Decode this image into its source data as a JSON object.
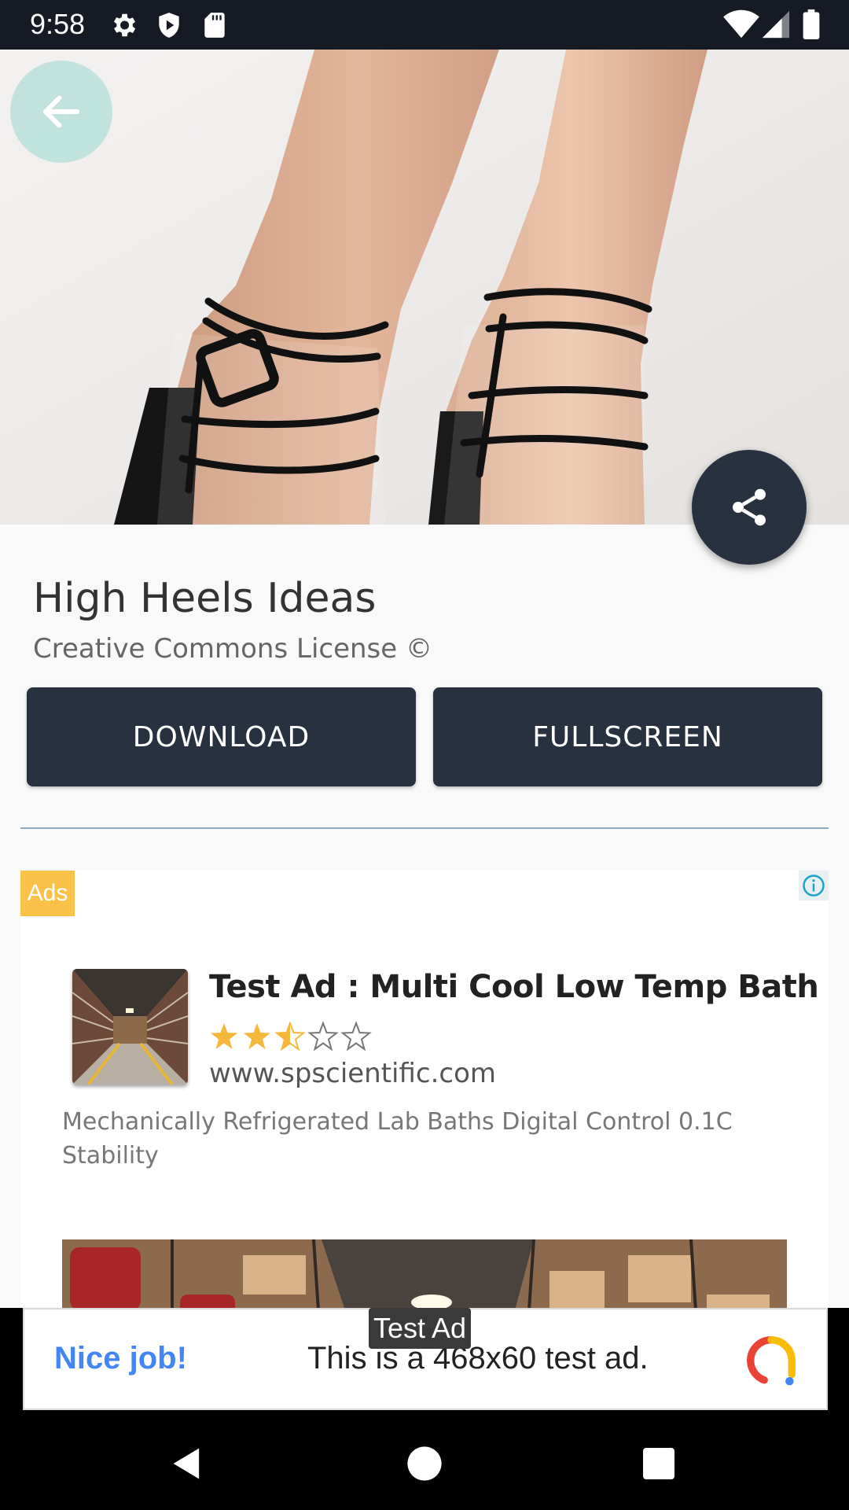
{
  "status_bar": {
    "time": "9:58",
    "left_icons": [
      "gear-icon",
      "play-shield-icon",
      "sd-card-icon"
    ],
    "right_icons": [
      "wifi-icon",
      "cell-signal-icon",
      "battery-icon"
    ]
  },
  "hero": {
    "image": "high-heels-photo",
    "back_icon": "arrow-left-icon",
    "share_icon": "share-icon"
  },
  "content": {
    "title": "High Heels Ideas",
    "subtitle": "Creative Commons License ©",
    "download_label": "DOWNLOAD",
    "fullscreen_label": "FULLSCREEN"
  },
  "ad": {
    "badge": "Ads",
    "headline": "Test Ad : Multi Cool Low Temp Bath",
    "rating": 2.5,
    "rating_max": 5,
    "url": "www.spscientific.com",
    "description": "Mechanically Refrigerated Lab Baths Digital Control 0.1C Stability",
    "info_icon": "info-icon"
  },
  "banner": {
    "label": "Test Ad",
    "nice": "Nice job!",
    "text": "This is a 468x60 test ad."
  },
  "nav": {
    "back": "nav-back-icon",
    "home": "nav-home-icon",
    "recents": "nav-recents-icon"
  },
  "colors": {
    "dark_navy": "#273140",
    "status_bar": "#151a25",
    "ads_badge": "#fbc24a",
    "star": "#f6b83a",
    "nice_job_blue": "#4285f4"
  }
}
